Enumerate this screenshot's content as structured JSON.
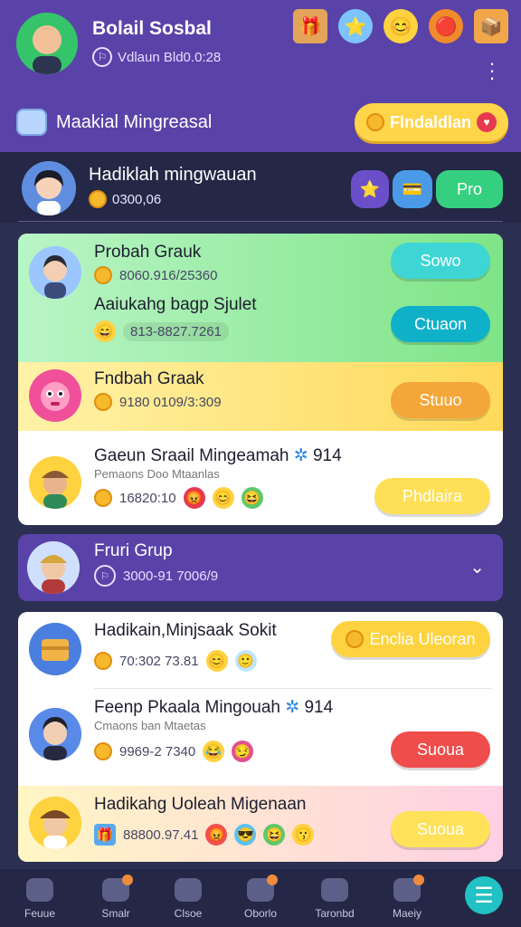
{
  "header": {
    "title": "Bolail Sosbal",
    "subtitle": "Vdlaun Bld0.0:28",
    "icons": [
      "gift-box-icon",
      "star-badge-icon",
      "smiley-icon",
      "orange-coin-icon",
      "treasure-chest-icon"
    ],
    "section_title": "Maakial Mingreasal",
    "promo_button": "Flndaldlan"
  },
  "profile": {
    "name": "Hadiklah mingwauan",
    "coins": "0300,06",
    "buttons": {
      "pro": "Pro"
    }
  },
  "rows": [
    {
      "title": "Probah Grauk",
      "meta": "8060.916/25360",
      "action": "Sowo",
      "action_color": "#3dd6d4"
    },
    {
      "title": "Aaiukahg bagp Sjulet",
      "meta": "813-8827.7261",
      "action": "Ctuaon",
      "action_color": "#0fb1c9"
    },
    {
      "title": "Fndbah Graak",
      "meta": "9180 0109/3:309",
      "action": "Stuuo",
      "action_color": "#f5a638"
    },
    {
      "title": "Gaeun Sraail Mingeamah",
      "title_suffix": "914",
      "sub": "Pemaons Doo Mtaanlas",
      "meta": "16820:10",
      "action": "Phdlaira",
      "action_color": "#ffdf55"
    },
    {
      "title": "Fruri Grup",
      "meta": "3000-91 7006/9"
    },
    {
      "title": "Hadikain,Minjsaak Sokit",
      "meta": "70:302 73.81",
      "action": "Enclia Uleoran",
      "action_color": "#ffd33f"
    },
    {
      "title": "Feenp Pkaala Mingouah",
      "title_suffix": "914",
      "sub": "Cmaons ban Mtaetas",
      "meta": "9969-2 7340",
      "action": "Suoua",
      "action_color": "#ef4c4c"
    },
    {
      "title": "Hadikahg Uoleah Migenaan",
      "meta": "88800.97.41",
      "action": "Suoua",
      "action_color": "#ffe15a"
    }
  ],
  "nav": [
    {
      "label": "Feuue"
    },
    {
      "label": "Smalr"
    },
    {
      "label": "Clsoe"
    },
    {
      "label": "Oborlo"
    },
    {
      "label": "Taronbd"
    },
    {
      "label": "Maeiy"
    }
  ],
  "colors": {
    "header": "#5a43a8",
    "background": "#2b2f52",
    "accent": "#22c1c3"
  }
}
